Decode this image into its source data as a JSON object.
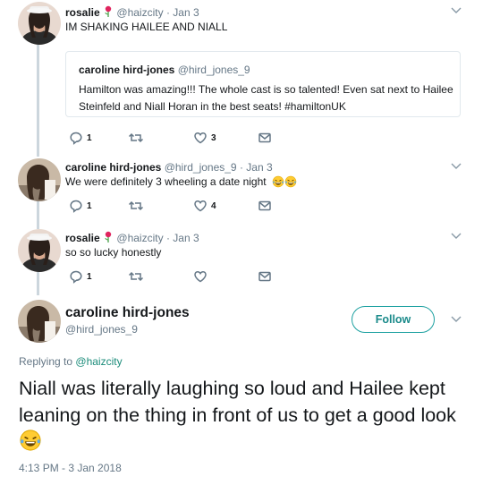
{
  "tweets": [
    {
      "name": "rosalie",
      "handle": "@haizcity",
      "date": "· Jan 3",
      "text": "IM SHAKING HAILEE AND NIALL",
      "quote": {
        "name": "caroline hird-jones",
        "handle": "@hird_jones_9",
        "text": "Hamilton was amazing!!! The whole cast is so talented! Even sat next to Hailee Steinfeld and Niall Horan in the best seats! #hamiltonUK"
      },
      "actions": {
        "reply": "1",
        "retweet": "",
        "like": "3"
      }
    },
    {
      "name": "caroline hird-jones",
      "handle": "@hird_jones_9",
      "date": "· Jan 3",
      "text": "We were definitely 3 wheeling a date night",
      "actions": {
        "reply": "1",
        "retweet": "",
        "like": "4"
      }
    },
    {
      "name": "rosalie",
      "handle": "@haizcity",
      "date": "· Jan 3",
      "text": "so so lucky honestly",
      "actions": {
        "reply": "1",
        "retweet": "",
        "like": ""
      }
    }
  ],
  "main_tweet": {
    "name": "caroline hird-jones",
    "handle": "@hird_jones_9",
    "follow_label": "Follow",
    "replying_prefix": "Replying to",
    "replying_to": "@haizcity",
    "text": "Niall was literally laughing so loud and Hailee kept leaning on the thing in front of us to get a good look",
    "timestamp": "4:13 PM - 3 Jan 2018"
  },
  "icons": {
    "reply": "reply-icon",
    "retweet": "retweet-icon",
    "like": "heart-icon",
    "dm": "envelope-icon",
    "caret": "chevron-down-icon",
    "rose": "rose-emoji",
    "laugh": "tears-of-joy-emoji"
  },
  "colors": {
    "action_icon": "#657786",
    "follow_accent": "#1da1a1",
    "mention": "#1b8c7a",
    "thread_line": "#ccd6dd"
  }
}
